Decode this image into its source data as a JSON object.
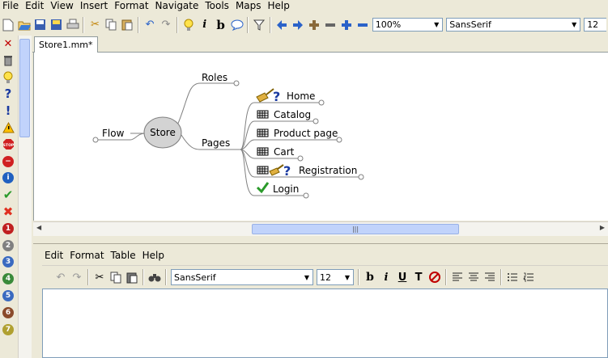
{
  "menubar": [
    "File",
    "Edit",
    "View",
    "Insert",
    "Format",
    "Navigate",
    "Tools",
    "Maps",
    "Help"
  ],
  "toolbar": {
    "zoom": "100%",
    "font": "SansSerif",
    "size": "12"
  },
  "tab": {
    "label": "Store1.mm*"
  },
  "mindmap": {
    "root": "Store",
    "flow": "Flow",
    "roles": "Roles",
    "pages": "Pages",
    "children": [
      "Home",
      "Catalog",
      "Product page",
      "Cart",
      "Registration",
      "Login"
    ]
  },
  "left_icons": [
    "close-icon",
    "trash-icon",
    "bulb-icon",
    "question-icon",
    "exclamation-icon",
    "warning-icon",
    "stop-icon",
    "minus-circle-icon",
    "info-icon",
    "check-icon",
    "cross-icon",
    "priority-1-icon",
    "priority-2-icon",
    "priority-3-icon",
    "priority-4-icon",
    "priority-5-icon",
    "priority-6-icon",
    "priority-7-icon"
  ],
  "priority_numbers": [
    "1",
    "2",
    "3",
    "4",
    "5",
    "6",
    "7"
  ],
  "editor": {
    "menu": [
      "Edit",
      "Format",
      "Table",
      "Help"
    ],
    "font": "SansSerif",
    "size": "12"
  }
}
